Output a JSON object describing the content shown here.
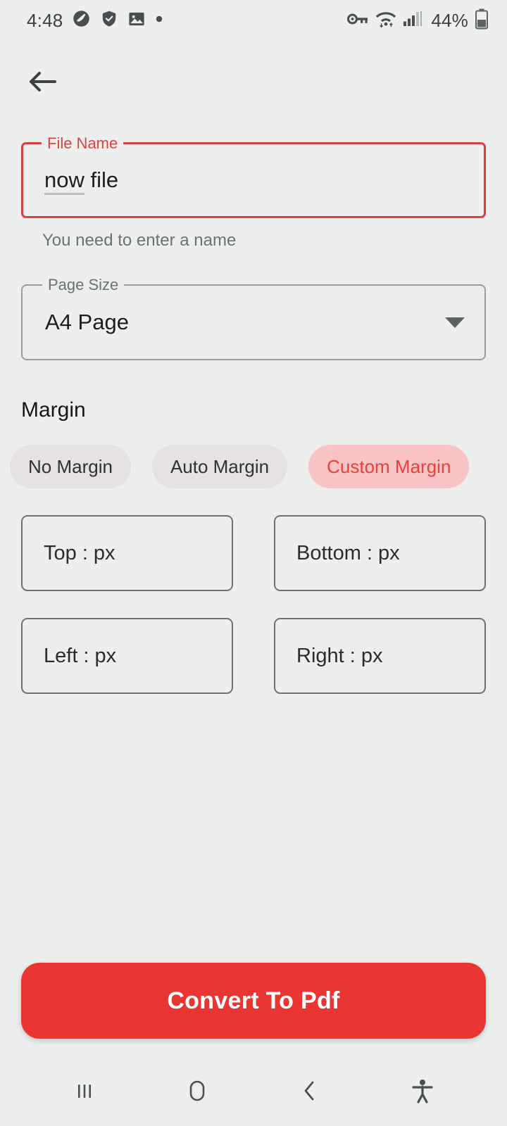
{
  "status_bar": {
    "time": "4:48",
    "battery_percent": "44%",
    "left_icons": [
      "do-not-disturb-icon",
      "shield-check-icon",
      "image-icon",
      "dot-icon"
    ],
    "right_icons": [
      "vpn-key-icon",
      "wifi-icon",
      "cellular-signal-icon",
      "battery-icon"
    ]
  },
  "app_bar": {
    "back_icon": "back-arrow-icon"
  },
  "file_name_field": {
    "label": "File Name",
    "value_composing": "now",
    "value_rest": " file",
    "value": "now file",
    "placeholder": "File Name",
    "helper_text": "You need to enter a name",
    "error_color": "#d9433f"
  },
  "page_size_field": {
    "label": "Page Size",
    "value": "A4 Page",
    "dropdown_icon": "chevron-down-icon"
  },
  "margin_section": {
    "title": "Margin",
    "chips": [
      {
        "label": "No Margin",
        "selected": false
      },
      {
        "label": "Auto Margin",
        "selected": false
      },
      {
        "label": "Custom Margin",
        "selected": true
      }
    ],
    "selected_chip_bg": "#fbc4c4",
    "selected_chip_text": "#e8413c",
    "inputs": [
      {
        "label": "Top : px",
        "placeholder": "Top : px",
        "value": ""
      },
      {
        "label": "Bottom : px",
        "placeholder": "Bottom : px",
        "value": ""
      },
      {
        "label": "Left : px",
        "placeholder": "Left : px",
        "value": ""
      },
      {
        "label": "Right : px",
        "placeholder": "Right : px",
        "value": ""
      }
    ]
  },
  "primary_action": {
    "label": "Convert To Pdf",
    "color": "#ea3633"
  },
  "nav_bar": {
    "buttons": [
      {
        "name": "recents-icon"
      },
      {
        "name": "home-icon"
      },
      {
        "name": "back-icon"
      },
      {
        "name": "accessibility-icon"
      }
    ]
  },
  "theme": {
    "background": "#ecefee",
    "accent": "#ea3633"
  }
}
